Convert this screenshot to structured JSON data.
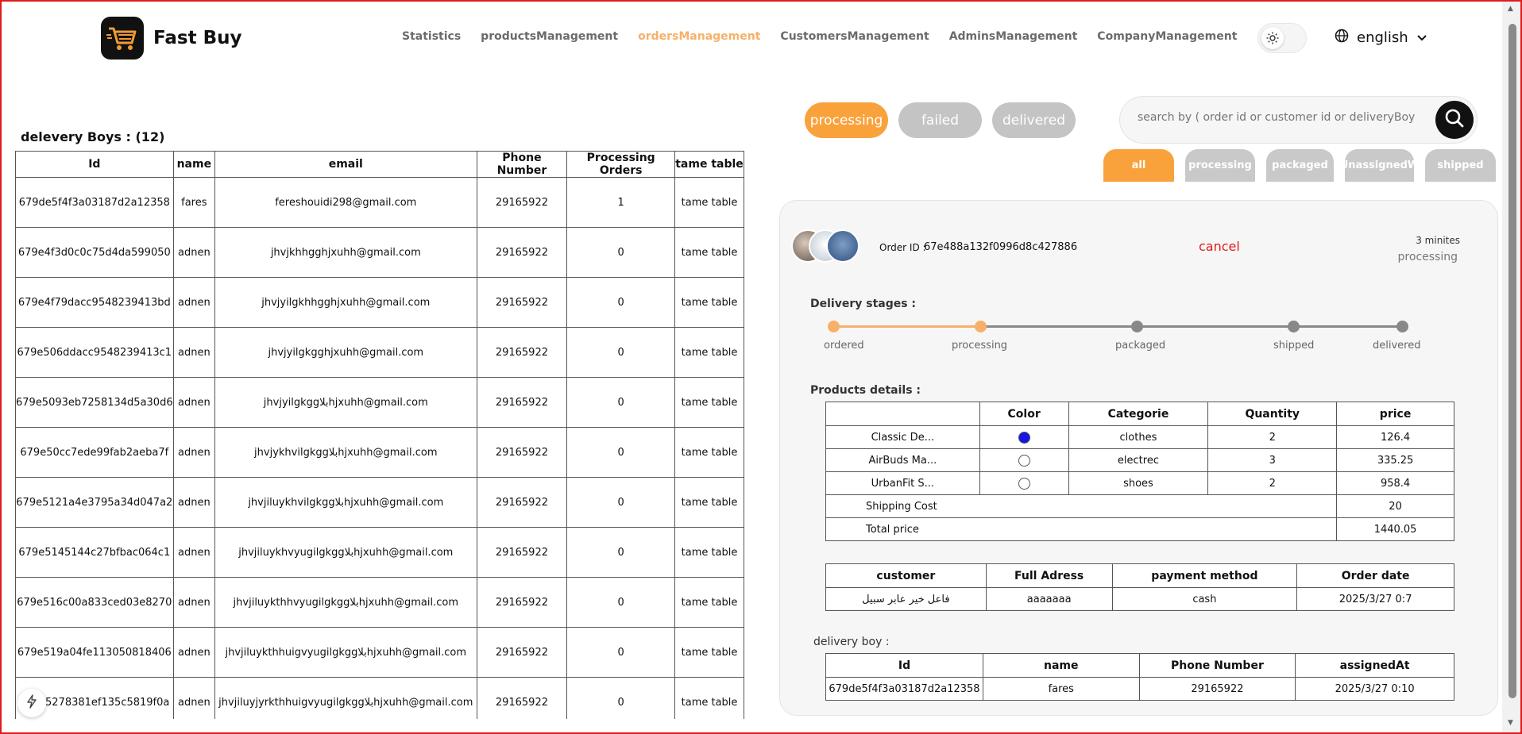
{
  "brand": {
    "name": "Fast Buy"
  },
  "nav": [
    {
      "label": "Statistics",
      "active": false
    },
    {
      "label": "productsManagement",
      "active": false
    },
    {
      "label": "ordersManagement",
      "active": true
    },
    {
      "label": "CustomersManagement",
      "active": false
    },
    {
      "label": "AdminsManagement",
      "active": false
    },
    {
      "label": "CompanyManagement",
      "active": false
    }
  ],
  "language": {
    "selected": "english"
  },
  "delivery_boys": {
    "title": "delevery Boys : (12)",
    "columns": [
      "Id",
      "name",
      "email",
      "Phone Number",
      "Processing Orders",
      "tame table"
    ],
    "rows": [
      [
        "679de5f4f3a03187d2a12358",
        "fares",
        "fereshouidi298@gmail.com",
        "29165922",
        "1",
        "tame table"
      ],
      [
        "679e4f3d0c0c75d4da599050",
        "adnen",
        "jhvjkhhgghjxuhh@gmail.com",
        "29165922",
        "0",
        "tame table"
      ],
      [
        "679e4f79dacc9548239413bd",
        "adnen",
        "jhvjyilgkhhgghjxuhh@gmail.com",
        "29165922",
        "0",
        "tame table"
      ],
      [
        "679e506ddacc9548239413c1",
        "adnen",
        "jhvjyilgkgghjxuhh@gmail.com",
        "29165922",
        "0",
        "tame table"
      ],
      [
        "679e5093eb7258134d5a30d6",
        "adnen",
        "jhvjyilgkggبلاhjxuhh@gmail.com",
        "29165922",
        "0",
        "tame table"
      ],
      [
        "679e50cc7ede99fab2aeba7f",
        "adnen",
        "jhvjykhvilgkggبلاhjxuhh@gmail.com",
        "29165922",
        "0",
        "tame table"
      ],
      [
        "679e5121a4e3795a34d047a2",
        "adnen",
        "jhvjiluykhvilgkggبلاhjxuhh@gmail.com",
        "29165922",
        "0",
        "tame table"
      ],
      [
        "679e5145144c27bfbac064c1",
        "adnen",
        "jhvjiluykhvyugilgkggبلاhjxuhh@gmail.com",
        "29165922",
        "0",
        "tame table"
      ],
      [
        "679e516c00a833ced03e8270",
        "adnen",
        "jhvjiluykthhvyugilgkggبلاhjxuhh@gmail.com",
        "29165922",
        "0",
        "tame table"
      ],
      [
        "679e519a04fe113050818406",
        "adnen",
        "jhvjiluykthhuigvyugilgkggبلاhjxuhh@gmail.com",
        "29165922",
        "0",
        "tame table"
      ],
      [
        "679e5278381ef135c5819f0a",
        "adnen",
        "jhvjiluyjyrkthhuigvyugilgkggبلاhjxuhh@gmail.com",
        "29165922",
        "0",
        "tame table"
      ]
    ]
  },
  "status_filters": [
    {
      "label": "processing",
      "active": true
    },
    {
      "label": "failed",
      "active": false
    },
    {
      "label": "delivered",
      "active": false
    }
  ],
  "search": {
    "placeholder": "search by ( order id or customer id or deliveryBoy id ) ..."
  },
  "sub_filters": [
    {
      "label": "all",
      "active": true
    },
    {
      "label": "processing",
      "active": false
    },
    {
      "label": "packaged",
      "active": false
    },
    {
      "label": "UnassignedW",
      "active": false
    },
    {
      "label": "shipped",
      "active": false
    }
  ],
  "order": {
    "id_label": "Order ID :",
    "id": "67e488a132f0996d8c427886",
    "cancel_label": "cancel",
    "time_ago": "3 minites",
    "status": "processing",
    "stages_label": "Delivery stages :",
    "stages": [
      "ordered",
      "processing",
      "packaged",
      "shipped",
      "delivered"
    ],
    "stage_reached": 1,
    "products_label": "Products details :",
    "products_columns": [
      "",
      "Color",
      "Categorie",
      "Quantity",
      "price"
    ],
    "products": [
      {
        "name": "Classic De...",
        "color": "#1515e6",
        "category": "clothes",
        "quantity": "2",
        "price": "126.4"
      },
      {
        "name": "AirBuds Ma...",
        "color": "#ffffff",
        "category": "electrec",
        "quantity": "3",
        "price": "335.25"
      },
      {
        "name": "UrbanFit S...",
        "color": "#ffffff",
        "category": "shoes",
        "quantity": "2",
        "price": "958.4"
      }
    ],
    "shipping_label": "Shipping Cost",
    "shipping_cost": "20",
    "total_label": "Total price",
    "total_price": "1440.05",
    "customer_columns": [
      "customer",
      "Full Adress",
      "payment method",
      "Order date"
    ],
    "customer": {
      "name": "فاعل خير عابر سبيل",
      "address": "aaaaaaa",
      "payment": "cash",
      "date": "2025/3/27 0:7"
    },
    "delivery_label": "delivery boy :",
    "delivery_columns": [
      "Id",
      "name",
      "Phone Number",
      "assignedAt"
    ],
    "delivery_boy": {
      "id": "679de5f4f3a03187d2a12358",
      "name": "fares",
      "phone": "29165922",
      "assigned_at": "2025/3/27 0:10"
    }
  },
  "colors": {
    "accent": "#f9a23c",
    "nav_active": "#f7b06a",
    "pill_inactive": "#c4c4c4",
    "danger": "#e01b1b"
  },
  "icons": [
    "cart-logo-icon",
    "sun-icon",
    "globe-icon",
    "chevron-down-icon",
    "search-icon",
    "flash-icon"
  ]
}
